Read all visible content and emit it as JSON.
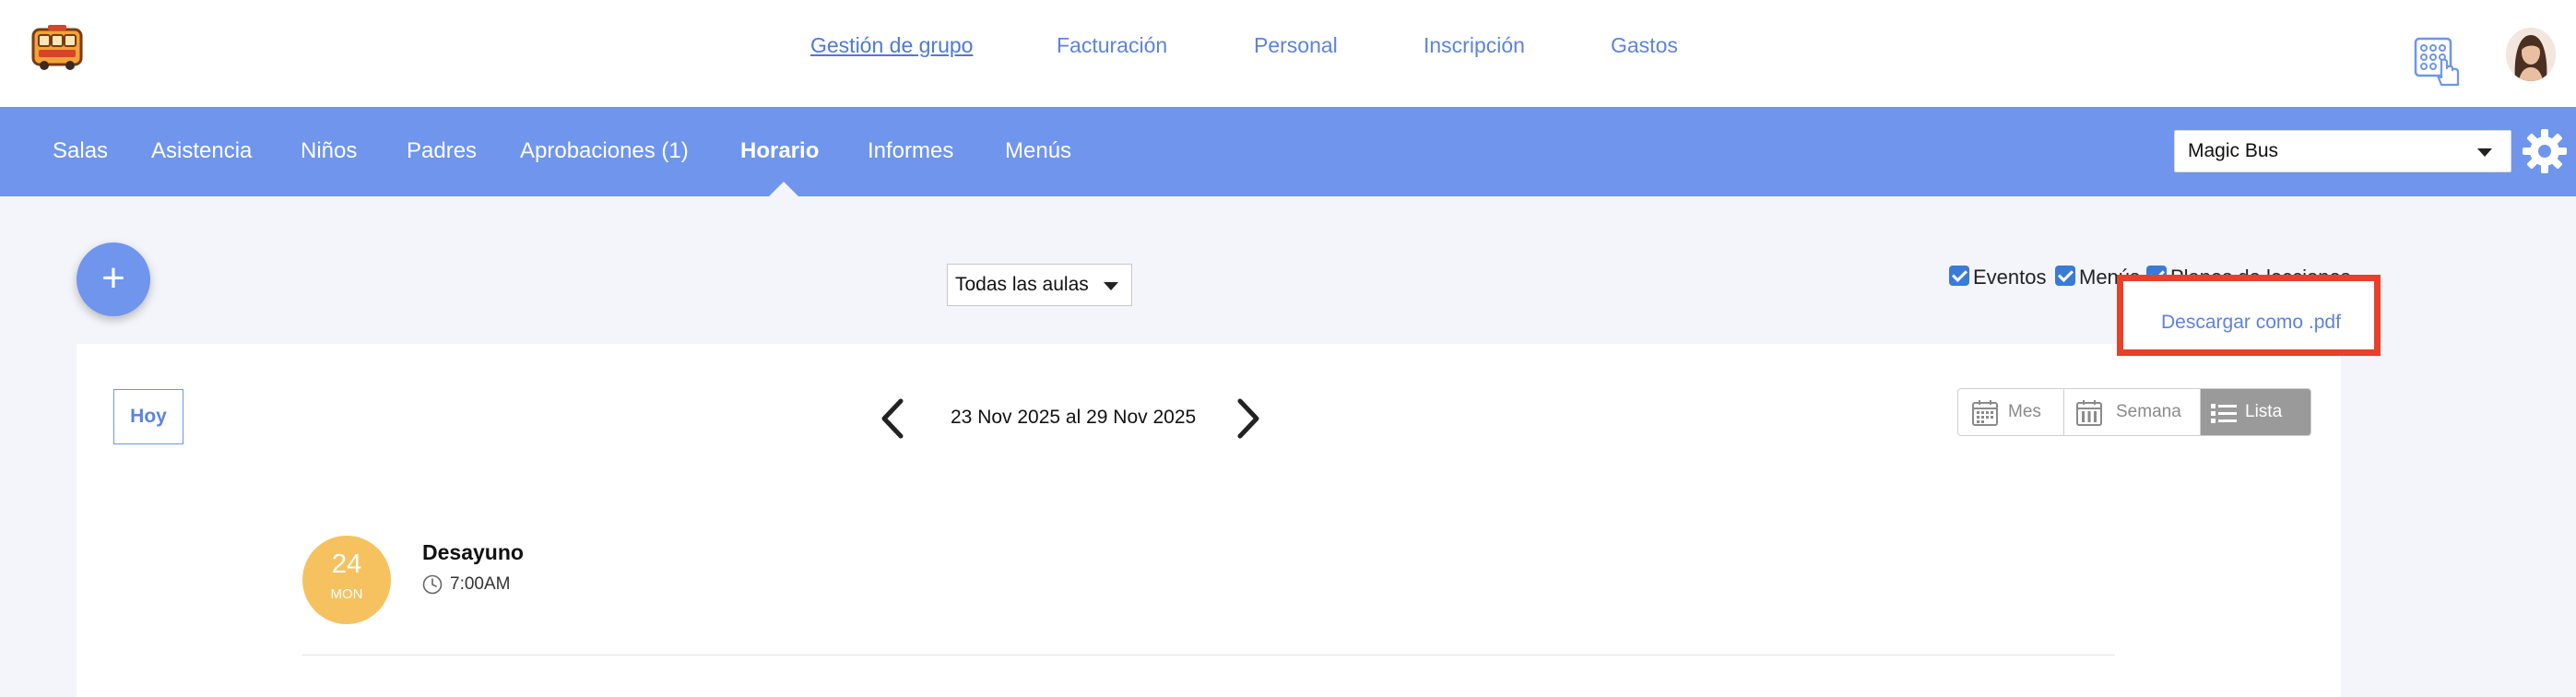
{
  "top_nav": {
    "items": [
      {
        "label": "Gestión de grupo",
        "active": true
      },
      {
        "label": "Facturación"
      },
      {
        "label": "Personal"
      },
      {
        "label": "Inscripción"
      },
      {
        "label": "Gastos"
      }
    ]
  },
  "main_nav": {
    "items": [
      {
        "label": "Salas"
      },
      {
        "label": "Asistencia"
      },
      {
        "label": "Niños"
      },
      {
        "label": "Padres"
      },
      {
        "label": "Aprobaciones (1)"
      },
      {
        "label": "Horario",
        "active": true
      },
      {
        "label": "Informes"
      },
      {
        "label": "Menús"
      }
    ],
    "school_select": "Magic Bus"
  },
  "toolbar": {
    "add_label": "+",
    "classroom_filter": "Todas las aulas",
    "filters": [
      {
        "label": "Eventos",
        "checked": true
      },
      {
        "label": "Menús",
        "checked": true
      },
      {
        "label": "Planes de lecciones",
        "checked": true
      }
    ],
    "download_pdf": "Descargar como .pdf"
  },
  "calendar": {
    "today_label": "Hoy",
    "date_range": "23 Nov 2025 al 29 Nov 2025",
    "views": [
      {
        "label": "Mes"
      },
      {
        "label": "Semana"
      },
      {
        "label": "Lista",
        "active": true
      }
    ],
    "events": [
      {
        "day": "24",
        "weekday": "MON",
        "title": "Desayuno",
        "time": "7:00AM"
      }
    ]
  },
  "colors": {
    "primary": "#6f95ec",
    "link": "#5b83e0",
    "highlight": "#e8402a",
    "date_badge": "#f6c260"
  }
}
